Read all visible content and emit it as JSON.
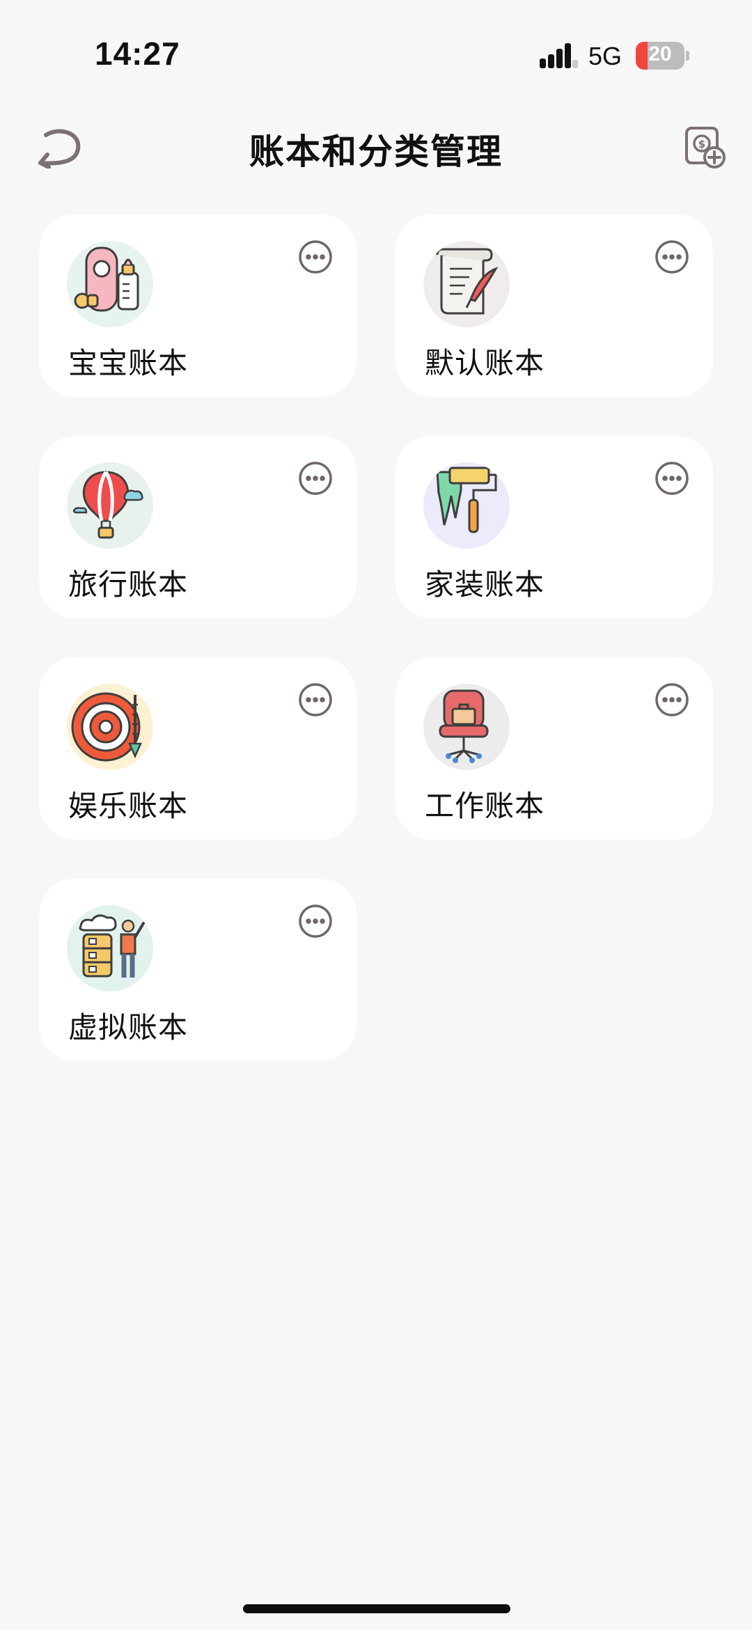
{
  "status_bar": {
    "time": "14:27",
    "network": "5G",
    "battery_level": "20",
    "battery_color": "#f0463c"
  },
  "header": {
    "title": "账本和分类管理",
    "back_icon": "back-arrow-icon",
    "add_icon": "add-book-icon"
  },
  "books": [
    {
      "name": "宝宝账本",
      "icon": "baby-bottle-icon",
      "bg": "#e7f3ee"
    },
    {
      "name": "默认账本",
      "icon": "scroll-quill-icon",
      "bg": "#f1ecec"
    },
    {
      "name": "旅行账本",
      "icon": "hot-air-balloon-icon",
      "bg": "#e9f1ec"
    },
    {
      "name": "家装账本",
      "icon": "paint-roller-icon",
      "bg": "#ecebfb"
    },
    {
      "name": "娱乐账本",
      "icon": "dart-target-icon",
      "bg": "#fdf1d3"
    },
    {
      "name": "工作账本",
      "icon": "office-chair-icon",
      "bg": "#ececec"
    },
    {
      "name": "虚拟账本",
      "icon": "server-person-icon",
      "bg": "#e2f3ee"
    }
  ],
  "more_icon": "more-options-icon"
}
